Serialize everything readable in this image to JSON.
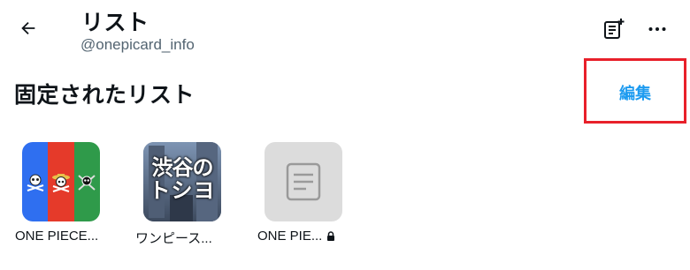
{
  "header": {
    "back_icon": "arrow-left-icon",
    "title": "リスト",
    "handle": "@onepicard_info",
    "new_list_icon": "create-list-icon",
    "more_icon": "more-horizontal-icon"
  },
  "pinned": {
    "section_title": "固定されたリスト",
    "edit_label": "編集",
    "accent_color": "#1d9bf0",
    "highlight_color": "#e8202a",
    "lists": [
      {
        "name": "ONE PIECE...",
        "image": "tricolor-pirate-flags",
        "stripe_colors": [
          "#2f6ff0",
          "#e53a2a",
          "#2f9a4a"
        ],
        "locked": false
      },
      {
        "name": "ワンピース...",
        "image": "shibuya-photo",
        "image_text_line1": "渋谷の",
        "image_text_line2": "トシヨ",
        "locked": false
      },
      {
        "name": "ONE PIE...",
        "image": "default-list-icon",
        "locked": true,
        "lock_icon": "lock-icon"
      }
    ]
  }
}
